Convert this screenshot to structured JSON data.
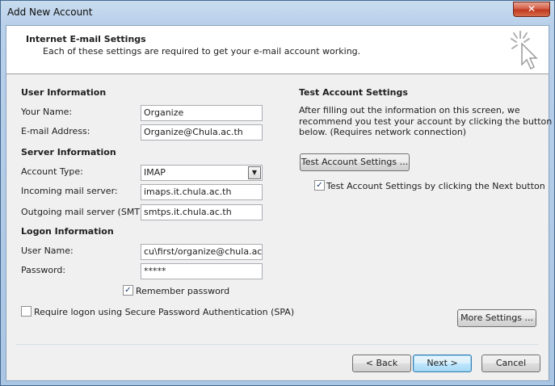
{
  "window": {
    "title": "Add New Account",
    "close_glyph": "✕"
  },
  "header": {
    "title": "Internet E-mail Settings",
    "subtitle": "Each of these settings are required to get your e-mail account working.",
    "icon": "wizard-cursor-icon"
  },
  "user_info": {
    "section_label": "User Information",
    "name_label": "Your Name:",
    "name_value": "Organize",
    "email_label": "E-mail Address:",
    "email_value": "Organize@Chula.ac.th"
  },
  "server_info": {
    "section_label": "Server Information",
    "account_type_label": "Account Type:",
    "account_type_value": "IMAP",
    "incoming_label": "Incoming mail server:",
    "incoming_value": "imaps.it.chula.ac.th",
    "outgoing_label": "Outgoing mail server (SMTP):",
    "outgoing_value": "smtps.it.chula.ac.th"
  },
  "logon_info": {
    "section_label": "Logon Information",
    "username_label": "User Name:",
    "username_value": "cu\\first/organize@chula.ac.th",
    "password_label": "Password:",
    "password_value": "*****",
    "remember_label": "Remember password",
    "remember_checked": true,
    "spa_label": "Require logon using Secure Password Authentication (SPA)",
    "spa_checked": false
  },
  "test_settings": {
    "section_label": "Test Account Settings",
    "description_line1": "After filling out the information on this screen, we",
    "description_line2": "recommend you test your account by clicking the button",
    "description_line3": "below. (Requires network connection)",
    "test_button_label": "Test Account Settings ...",
    "auto_test_label": "Test Account Settings by clicking the Next button",
    "auto_test_checked": true
  },
  "buttons": {
    "more_settings": "More Settings ...",
    "back": "< Back",
    "next": "Next >",
    "cancel": "Cancel"
  },
  "check_glyph": "✓",
  "dropdown_glyph": "▼"
}
